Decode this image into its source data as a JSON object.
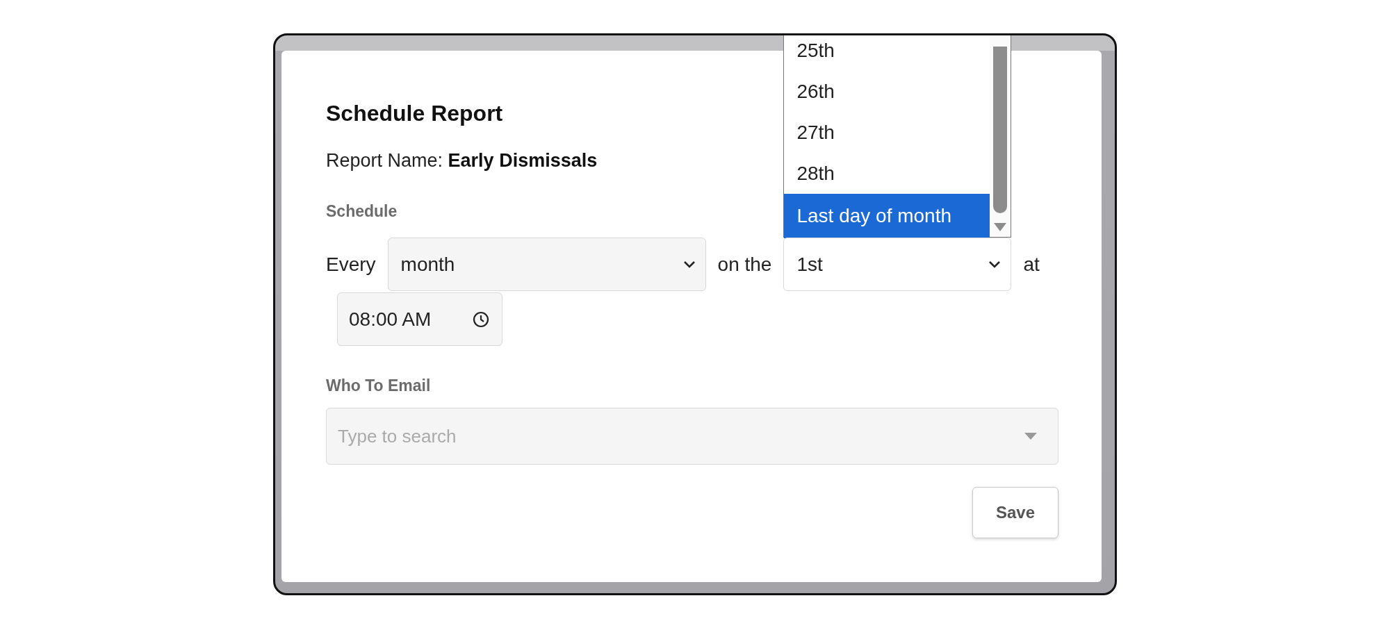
{
  "dialog": {
    "title": "Schedule Report",
    "report_name": "Report Name: **Early Dismissals**",
    "schedule_label": "Schedule",
    "every_label": "Every",
    "frequency_select": {
      "value": "month"
    },
    "on_the_label": "on the",
    "day_select": {
      "value": "1st",
      "expanded": true,
      "options": [
        {
          "label": "25th",
          "selected": false
        },
        {
          "label": "26th",
          "selected": false
        },
        {
          "label": "27th",
          "selected": false
        },
        {
          "label": "28th",
          "selected": false
        },
        {
          "label": "Last day of month",
          "selected": true
        }
      ]
    },
    "at_label": "at",
    "time_field": {
      "value": "08:00 AM"
    },
    "email_label": "Who To Email",
    "email_field": {
      "placeholder": "Type to search"
    },
    "save_button": "Save"
  }
}
